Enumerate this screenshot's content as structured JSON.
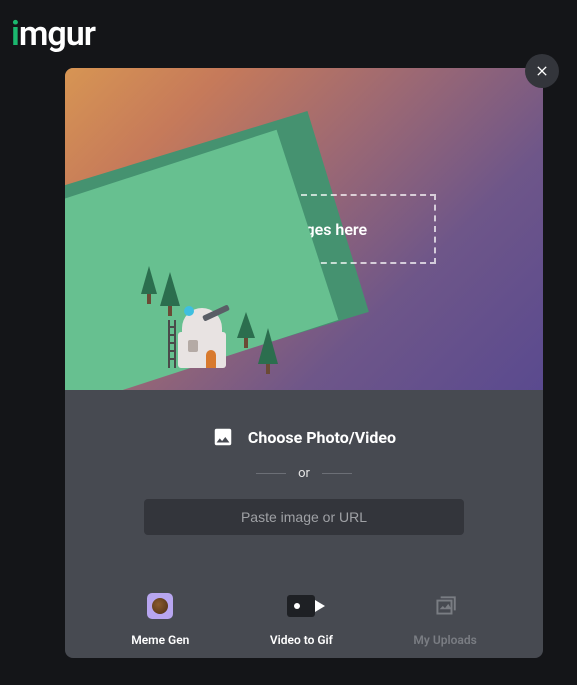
{
  "logo": {
    "text": "imgur"
  },
  "upload_modal": {
    "dropzone_label": "Drop images here",
    "choose_label": "Choose Photo/Video",
    "or_label": "or",
    "url_placeholder": "Paste image or URL",
    "tools": [
      {
        "label": "Meme Gen",
        "icon": "meme-icon",
        "enabled": true
      },
      {
        "label": "Video to Gif",
        "icon": "video-icon",
        "enabled": true
      },
      {
        "label": "My Uploads",
        "icon": "uploads-icon",
        "enabled": false
      }
    ]
  }
}
